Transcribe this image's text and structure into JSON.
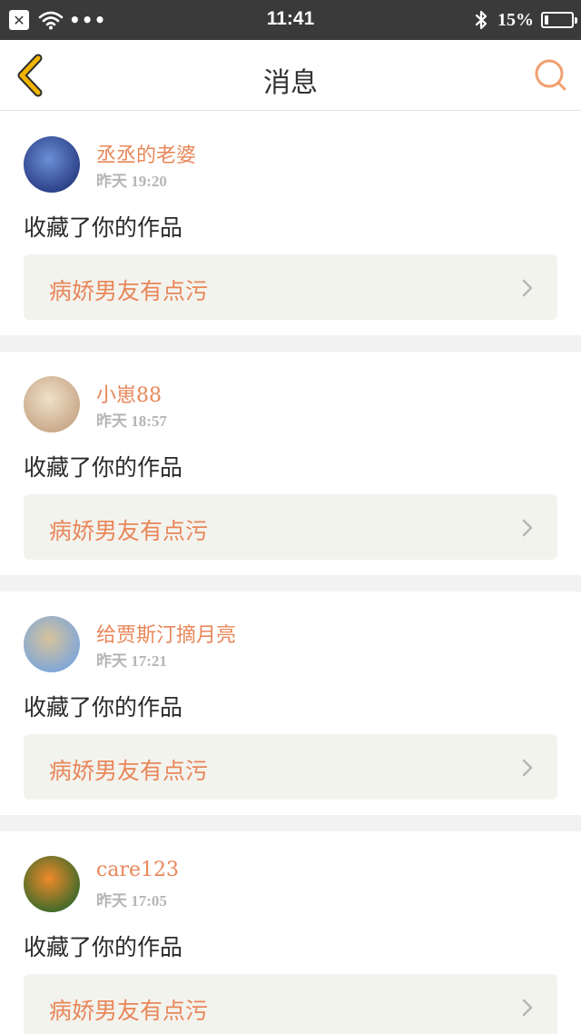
{
  "status_bar": {
    "time": "11:41",
    "battery_percent_text": "15%",
    "battery_level": 0.15,
    "icons": [
      "close-icon",
      "wifi-icon",
      "more-dots-icon",
      "bluetooth-icon",
      "battery-icon"
    ]
  },
  "header": {
    "title": "消息",
    "back_icon": "chevron-left-icon",
    "search_icon": "search-icon"
  },
  "messages": [
    {
      "username": "丞丞的老婆",
      "time": "昨天 19:20",
      "action": "收藏了你的作品",
      "work_title": "病娇男友有点污",
      "avatar_colors": [
        "#2b3f86",
        "#6b8fd6"
      ]
    },
    {
      "username": "小崽88",
      "time": "昨天 18:57",
      "action": "收藏了你的作品",
      "work_title": "病娇男友有点污",
      "avatar_colors": [
        "#c9a98a",
        "#efe1c8"
      ]
    },
    {
      "username": "给贾斯汀摘月亮",
      "time": "昨天 17:21",
      "action": "收藏了你的作品",
      "work_title": "病娇男友有点污",
      "avatar_colors": [
        "#7fa7d8",
        "#d7c39b"
      ]
    },
    {
      "username": "care123",
      "time": "昨天 17:05",
      "action": "收藏了你的作品",
      "work_title": "病娇男友有点污",
      "avatar_colors": [
        "#3f6a2a",
        "#f08a2a"
      ]
    }
  ],
  "colors": {
    "accent": "#e8875a",
    "status_bar_bg": "#3a3a3a",
    "card_box_bg": "#f3f3ee",
    "separator": "#f2f2f2",
    "back_icon": "#f0b400"
  }
}
